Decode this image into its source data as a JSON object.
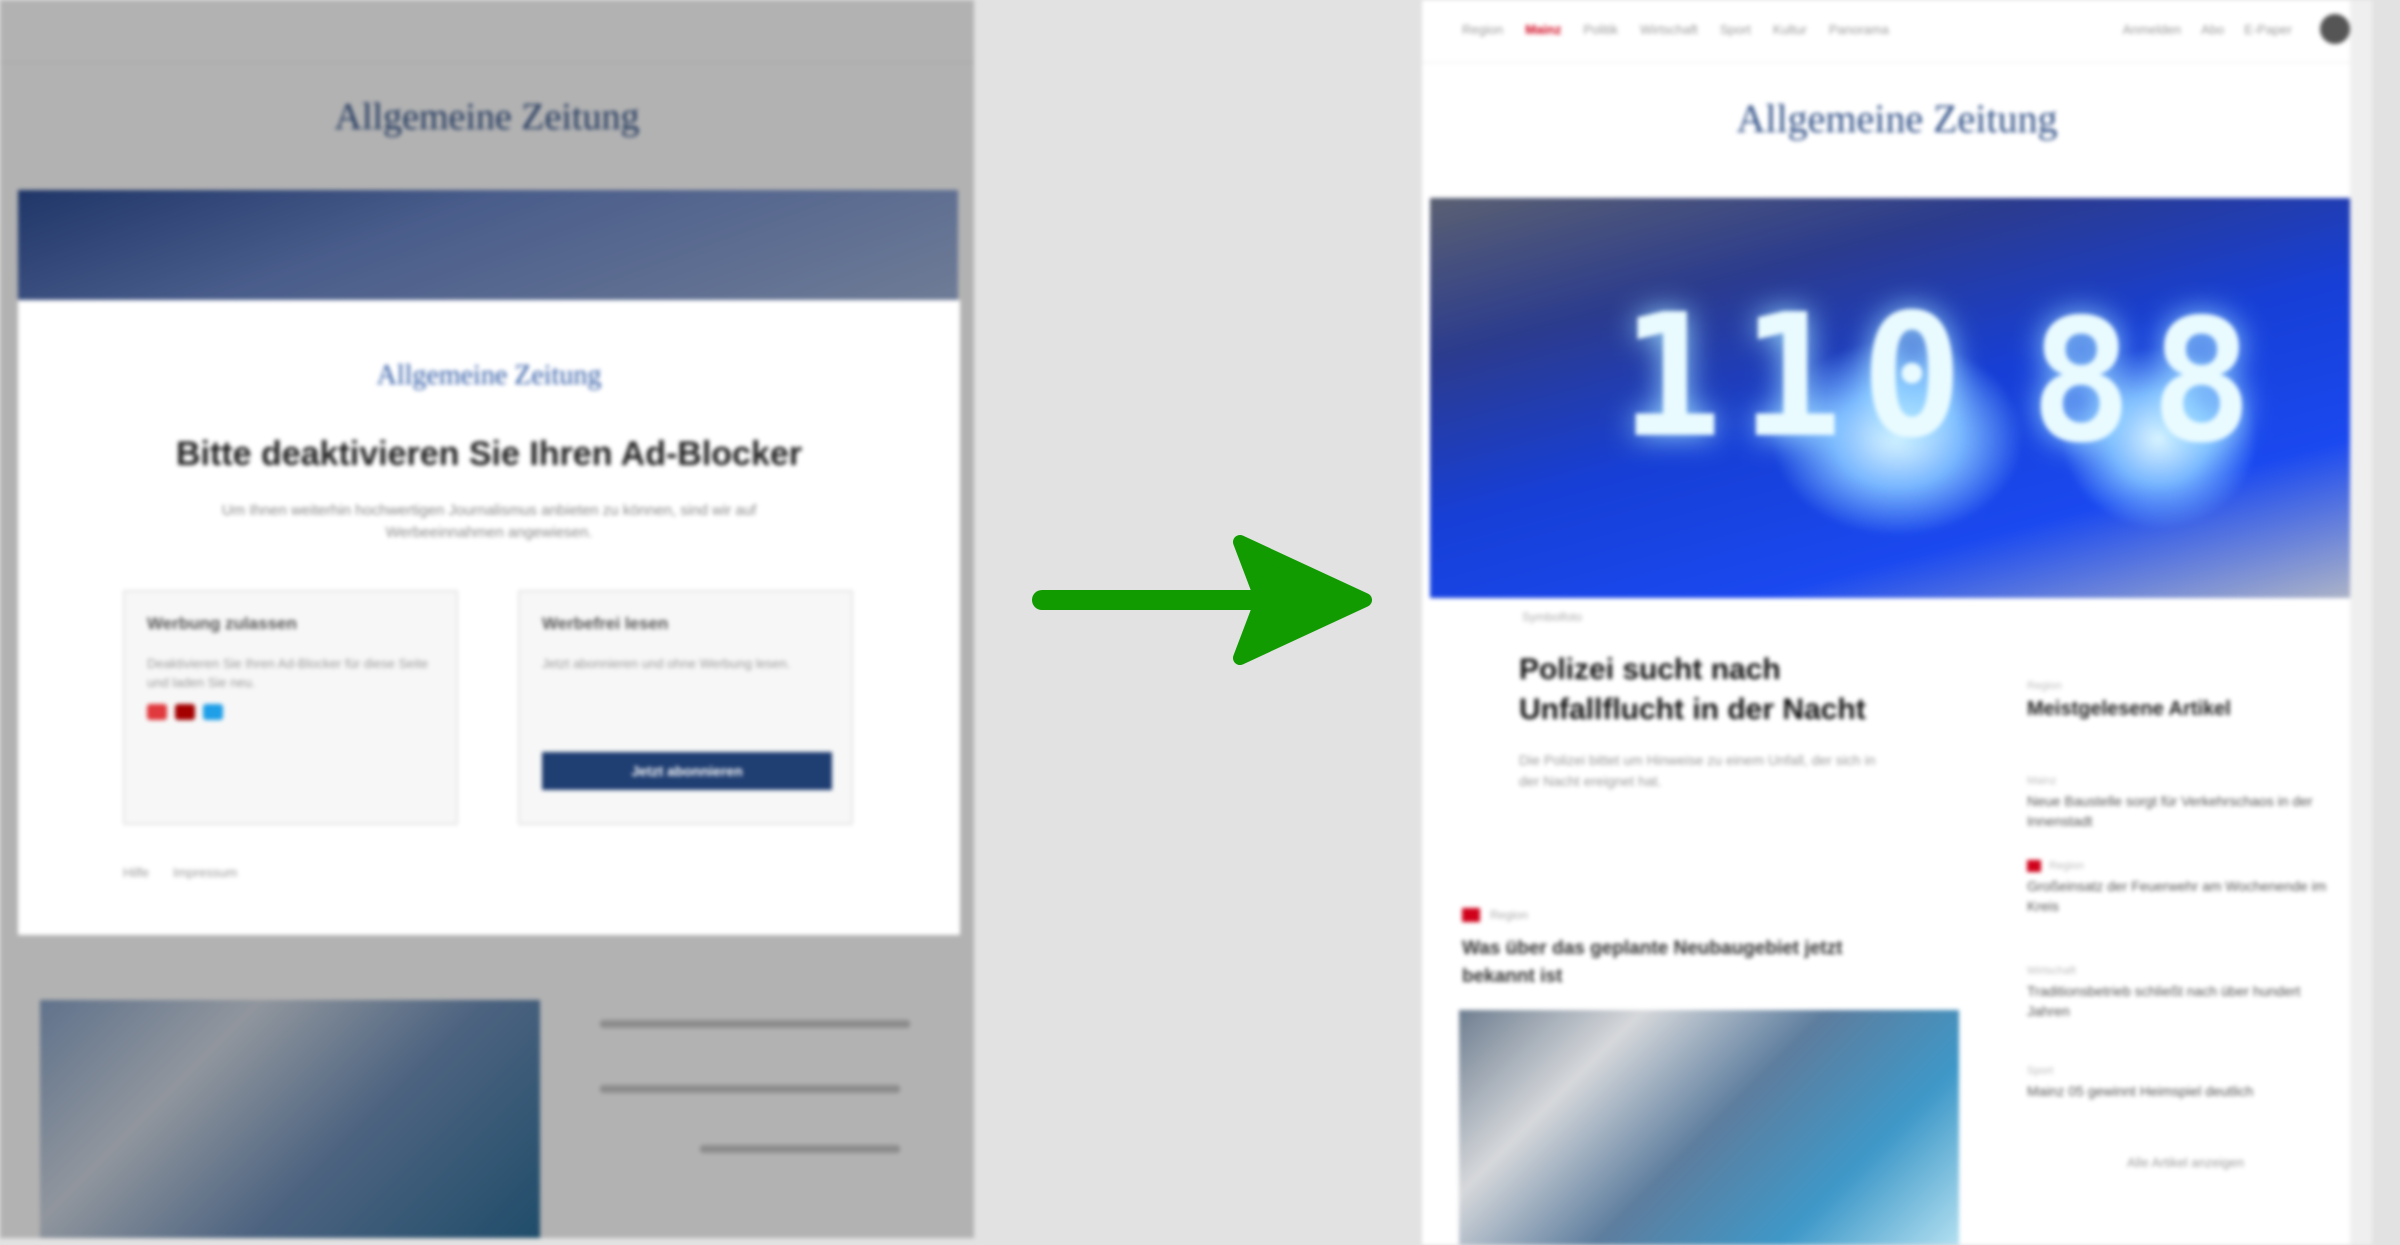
{
  "colors": {
    "accent_blue": "#2f4f86",
    "button_blue": "#1f3e72",
    "breaking_red": "#d0021b",
    "arrow_green": "#119b00"
  },
  "left": {
    "masthead": "Allgemeine Zeitung",
    "modal": {
      "logo": "Allgemeine Zeitung",
      "title": "Bitte deaktivieren Sie Ihren Ad-Blocker",
      "text": "Um Ihnen weiterhin hochwertigen Journalismus anbieten zu können, sind wir auf Werbeeinnahmen angewiesen.",
      "option_1": {
        "title": "Werbung zulassen",
        "text": "Deaktivieren Sie Ihren Ad-Blocker für diese Seite und laden Sie neu.",
        "icons": [
          "adblock-icon",
          "ublock-icon",
          "ghostery-icon"
        ]
      },
      "option_2": {
        "title": "Werbefrei lesen",
        "text": "Jetzt abonnieren und ohne Werbung lesen.",
        "button": "Jetzt abonnieren"
      },
      "links": [
        "Hilfe",
        "Impressum"
      ]
    }
  },
  "right": {
    "nav": [
      "Region",
      "Mainz",
      "Politik",
      "Wirtschaft",
      "Sport",
      "Kultur",
      "Panorama"
    ],
    "nav_hot": "Mainz",
    "top_links": [
      "Anmelden",
      "Abo",
      "E-Paper"
    ],
    "masthead": "Allgemeine Zeitung",
    "hero_led": [
      "110",
      "88"
    ],
    "hero_caption": "Symbolfoto",
    "headline": "Polizei sucht nach Unfallflucht in der Nacht",
    "teaser": "Die Polizei bittet um Hinweise zu einem Unfall, der sich in der Nacht ereignet hat.",
    "second": {
      "tag": "Region",
      "headline": "Was über das geplante Neubaugebiet jetzt bekannt ist"
    },
    "sidebar": {
      "label": "Region",
      "title": "Meistgelesene Artikel",
      "items": [
        {
          "meta": "Mainz",
          "title": "Neue Baustelle sorgt für Verkehrschaos in der Innenstadt"
        },
        {
          "meta": "Region",
          "title": "Großeinsatz der Feuerwehr am Wochenende im Kreis"
        },
        {
          "meta": "Wirtschaft",
          "title": "Traditionsbetrieb schließt nach über hundert Jahren"
        },
        {
          "meta": "Sport",
          "title": "Mainz 05 gewinnt Heimspiel deutlich"
        }
      ],
      "more": "Alle Artikel anzeigen"
    }
  }
}
